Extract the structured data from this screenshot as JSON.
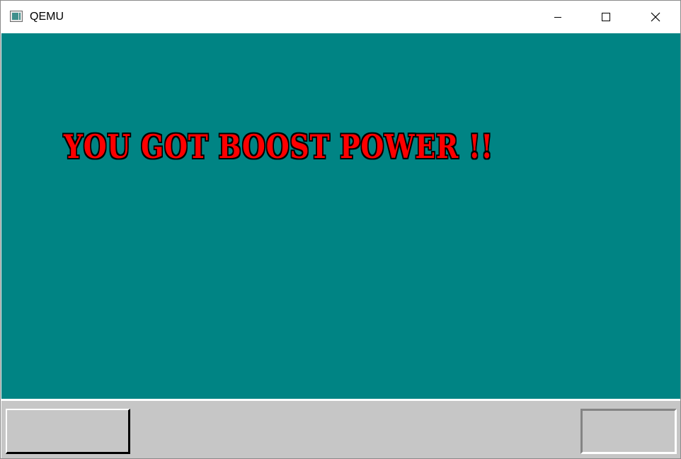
{
  "window": {
    "title": "QEMU",
    "icon": "qemu-app-icon",
    "controls": {
      "minimize_icon": "minimize-icon",
      "maximize_icon": "maximize-icon",
      "close_icon": "close-icon"
    }
  },
  "screen": {
    "background_color": "#008484",
    "message": "YOU GOT BOOST POWER !!",
    "message_color": "#ff0000"
  },
  "taskbar": {
    "background_color": "#c6c6c6",
    "start_button_label": "",
    "tray_text": ""
  }
}
